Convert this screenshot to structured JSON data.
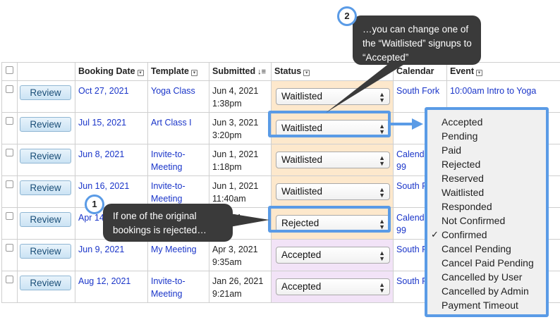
{
  "table": {
    "headers": {
      "booking_date": "Booking Date",
      "template": "Template",
      "submitted": "Submitted",
      "status": "Status",
      "calendar": "Calendar",
      "event": "Event"
    },
    "rows": [
      {
        "action": "Review",
        "booking_date": "Oct 27, 2021",
        "template": "Yoga Class",
        "submitted": "Jun 4, 2021 1:38pm",
        "status": "Waitlisted",
        "calendar": "South Fork",
        "event": "10:00am Intro to Yoga"
      },
      {
        "action": "Review",
        "booking_date": "Jul 15, 2021",
        "template": "Art Class I",
        "submitted": "Jun 3, 2021 3:20pm",
        "status": "Waitlisted",
        "calendar": "",
        "event": ""
      },
      {
        "action": "Review",
        "booking_date": "Jun 8, 2021",
        "template": "Invite-to-Meeting",
        "submitted": "Jun 1, 2021 1:18pm",
        "status": "Waitlisted",
        "calendar": "Calendar 99",
        "event": ""
      },
      {
        "action": "Review",
        "booking_date": "Jun 16, 2021",
        "template": "Invite-to-Meeting",
        "submitted": "Jun 1, 2021 11:40am",
        "status": "Waitlisted",
        "calendar": "South F",
        "event": ""
      },
      {
        "action": "Review",
        "booking_date": "Apr 14",
        "template": "",
        "submitted": "3, 2021",
        "status": "Rejected",
        "calendar": "Calendar 99",
        "event": ""
      },
      {
        "action": "Review",
        "booking_date": "Jun 9, 2021",
        "template": "My Meeting",
        "submitted": "Apr 3, 2021 9:35am",
        "status": "Accepted",
        "calendar": "South F",
        "event": ""
      },
      {
        "action": "Review",
        "booking_date": "Aug 12, 2021",
        "template": "Invite-to-Meeting",
        "submitted": "Jan 26, 2021 9:21am",
        "status": "Accepted",
        "calendar": "South F",
        "event": ""
      }
    ]
  },
  "status_menu": {
    "options": [
      "Accepted",
      "Pending",
      "Paid",
      "Rejected",
      "Reserved",
      "Waitlisted",
      "Responded",
      "Not Confirmed",
      "Confirmed",
      "Cancel Pending",
      "Cancel Paid Pending",
      "Cancelled by User",
      "Cancelled by Admin",
      "Payment Timeout"
    ],
    "checked": "Confirmed",
    "check_mark": "✓"
  },
  "callouts": [
    {
      "number": "1",
      "text": "If one of the original bookings is rejected…"
    },
    {
      "number": "2",
      "text": "…you can change one of the “Waitlisted” signups to “Accepted”"
    }
  ],
  "colors": {
    "highlight": "#5a9be6",
    "callout_bg": "#3a3a3a",
    "link": "#1a35c9",
    "status_pending_bg": "#fde8cc",
    "status_accepted_bg": "#f2e3f7"
  }
}
